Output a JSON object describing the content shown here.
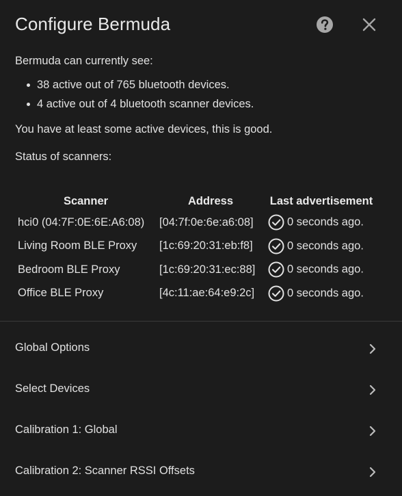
{
  "dialog": {
    "title": "Configure Bermuda",
    "help_icon": "help-circle-icon",
    "close_icon": "close-icon"
  },
  "summary": {
    "intro": "Bermuda can currently see:",
    "bullets": [
      "38 active out of 765 bluetooth devices.",
      "4 active out of 4 bluetooth scanner devices."
    ],
    "status_message": "You have at least some active devices, this is good.",
    "scanners_label": "Status of scanners:"
  },
  "scanners_table": {
    "headers": [
      "Scanner",
      "Address",
      "Last advertisement"
    ],
    "rows": [
      {
        "scanner": "hci0 (04:7F:0E:6E:A6:08)",
        "address": "[04:7f:0e:6e:a6:08]",
        "last": "0 seconds ago."
      },
      {
        "scanner": "Living Room BLE Proxy",
        "address": "[1c:69:20:31:eb:f8]",
        "last": "0 seconds ago."
      },
      {
        "scanner": "Bedroom BLE Proxy",
        "address": "[1c:69:20:31:ec:88]",
        "last": "0 seconds ago."
      },
      {
        "scanner": "Office BLE Proxy",
        "address": "[4c:11:ae:64:e9:2c]",
        "last": "0 seconds ago."
      }
    ],
    "status_icon": "check-circle-icon"
  },
  "menu": {
    "items": [
      {
        "label": "Global Options"
      },
      {
        "label": "Select Devices"
      },
      {
        "label": "Calibration 1: Global"
      },
      {
        "label": "Calibration 2: Scanner RSSI Offsets"
      }
    ],
    "chevron_icon": "chevron-right-icon"
  },
  "colors": {
    "background": "#1c1c1c",
    "text": "#e1e1e1",
    "divider": "#3a3a3a"
  }
}
